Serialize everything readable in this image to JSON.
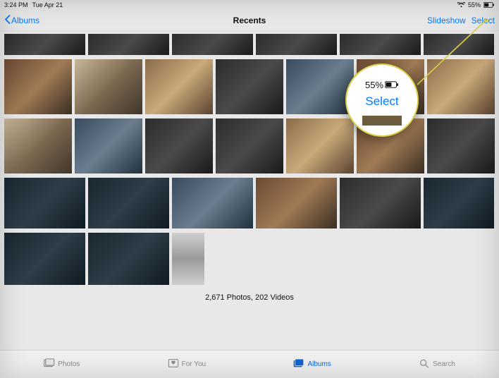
{
  "status": {
    "time": "3:24 PM",
    "date": "Tue Apr 21",
    "battery_pct": "55%"
  },
  "nav": {
    "back": "Albums",
    "title": "Recents",
    "slideshow": "Slideshow",
    "select": "Select"
  },
  "summary": "2,671 Photos, 202 Videos",
  "tabs": {
    "photos": "Photos",
    "for_you": "For You",
    "albums": "Albums",
    "search": "Search"
  },
  "callout": {
    "top_battery": "55%",
    "select": "Select"
  }
}
